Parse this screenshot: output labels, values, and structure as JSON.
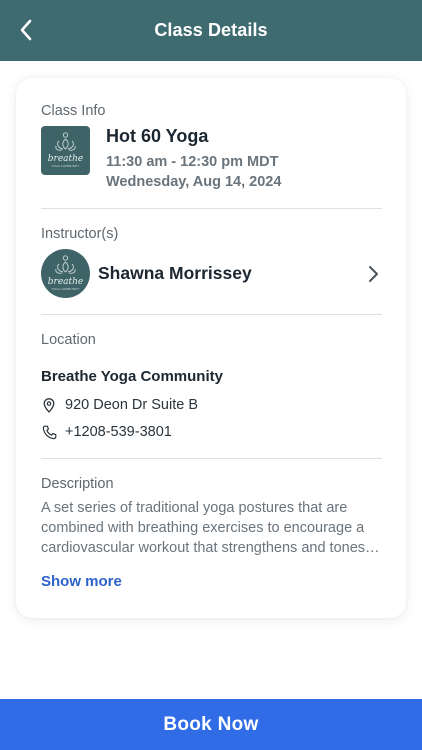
{
  "header": {
    "title": "Class Details",
    "back_icon": "chevron-left-icon"
  },
  "class_info": {
    "label": "Class Info",
    "logo_icon": "breathe-logo-icon",
    "name": "Hot 60 Yoga",
    "time": "11:30 am - 12:30 pm MDT",
    "date": "Wednesday, Aug 14, 2024"
  },
  "instructors": {
    "label": "Instructor(s)",
    "avatar_icon": "breathe-logo-icon",
    "name": "Shawna Morrissey",
    "chevron_icon": "chevron-right-icon"
  },
  "location": {
    "label": "Location",
    "studio": "Breathe Yoga Community",
    "address_icon": "map-pin-icon",
    "address": "920 Deon Dr Suite B",
    "phone_icon": "phone-icon",
    "phone": "+1208-539-3801"
  },
  "description": {
    "label": "Description",
    "text": "A set series of traditional yoga postures that are combined with breathing exercises to encourage a cardiovascular workout that strengthens and tones…",
    "show_more": "Show more"
  },
  "footer": {
    "book_label": "Book Now"
  },
  "colors": {
    "header_bg": "#3e6b70",
    "logo_bg": "#3f6467",
    "accent_link": "#2d63c8",
    "book_button": "#2f6ce6"
  }
}
